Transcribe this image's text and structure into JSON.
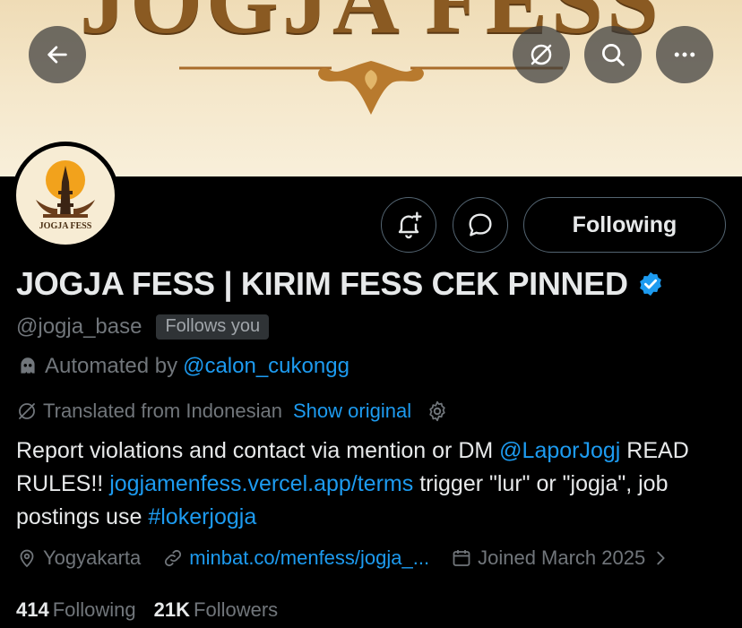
{
  "banner": {
    "title": "JOGJA FESS"
  },
  "colors": {
    "accent": "#1d9bf0",
    "background": "#000000",
    "muted": "#71767b",
    "banner_text": "#8a5a22"
  },
  "icons": {
    "back": "arrow-left-icon",
    "unsubscribe": "slashed-circle-icon",
    "search": "search-icon",
    "more": "more-horizontal-icon",
    "notify": "bell-plus-icon",
    "message": "chat-bubble-icon",
    "verified": "verified-badge-icon",
    "robot": "robot-icon",
    "translate": "translate-icon",
    "gear": "gear-icon",
    "location": "location-pin-icon",
    "link": "link-icon",
    "calendar": "calendar-icon",
    "chevron": "chevron-right-icon"
  },
  "avatar": {
    "label": "JOGJA FESS"
  },
  "actions": {
    "following_label": "Following"
  },
  "profile": {
    "display_name": "JOGJA FESS | KIRIM FESS CEK PINNED",
    "handle": "@jogja_base",
    "follows_you": "Follows you",
    "automated_prefix": "Automated by",
    "automated_by": "@calon_cukongg",
    "translated_text": "Translated from Indonesian",
    "show_original": "Show original"
  },
  "bio": {
    "part1": "Report violations and contact via mention or DM ",
    "mention": "@LaporJogj",
    "part2": " READ RULES!! ",
    "link": "jogjamenfess.vercel.app/terms",
    "part3": " trigger \"lur\" or \"jogja\", job postings use ",
    "hashtag": "#lokerjogja"
  },
  "meta": {
    "location": "Yogyakarta",
    "website": "minbat.co/menfess/jogja_...",
    "joined": "Joined March 2025"
  },
  "stats": {
    "following_count": "414",
    "following_label": "Following",
    "followers_count": "21K",
    "followers_label": "Followers"
  }
}
